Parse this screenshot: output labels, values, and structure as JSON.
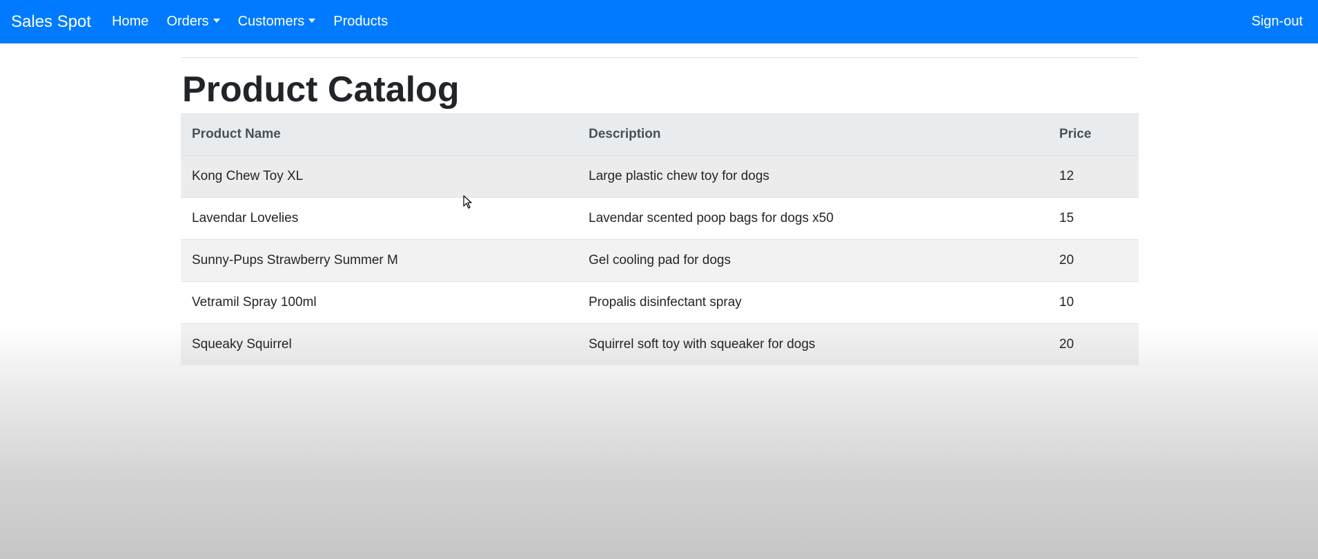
{
  "navbar": {
    "brand": "Sales Spot",
    "items": [
      {
        "label": "Home",
        "dropdown": false
      },
      {
        "label": "Orders",
        "dropdown": true
      },
      {
        "label": "Customers",
        "dropdown": true
      },
      {
        "label": "Products",
        "dropdown": false
      }
    ],
    "signout": "Sign-out",
    "color": "#007bff"
  },
  "page": {
    "title": "Product Catalog"
  },
  "table": {
    "headers": [
      "Product Name",
      "Description",
      "Price"
    ],
    "rows": [
      {
        "name": "Kong Chew Toy XL",
        "description": "Large plastic chew toy for dogs",
        "price": "12"
      },
      {
        "name": "Lavendar Lovelies",
        "description": "Lavendar scented poop bags for dogs x50",
        "price": "15"
      },
      {
        "name": "Sunny-Pups Strawberry Summer M",
        "description": "Gel cooling pad for dogs",
        "price": "20"
      },
      {
        "name": "Vetramil Spray 100ml",
        "description": "Propalis disinfectant spray",
        "price": "10"
      },
      {
        "name": "Squeaky Squirrel",
        "description": "Squirrel soft toy with squeaker for dogs",
        "price": "20"
      }
    ]
  },
  "icons": {
    "cursor": "mouse-pointer-icon",
    "dropdown": "caret-down-icon"
  }
}
